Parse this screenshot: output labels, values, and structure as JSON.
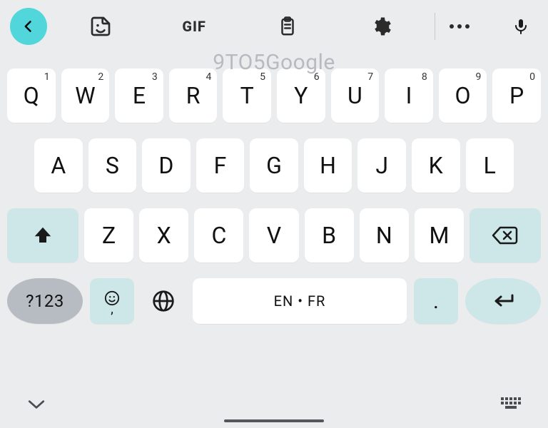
{
  "toolbar": {
    "gif_label": "GIF"
  },
  "watermark": "9TO5Google",
  "rows": {
    "r1": [
      {
        "l": "Q",
        "s": "1"
      },
      {
        "l": "W",
        "s": "2"
      },
      {
        "l": "E",
        "s": "3"
      },
      {
        "l": "R",
        "s": "4"
      },
      {
        "l": "T",
        "s": "5"
      },
      {
        "l": "Y",
        "s": "6"
      },
      {
        "l": "U",
        "s": "7"
      },
      {
        "l": "I",
        "s": "8"
      },
      {
        "l": "O",
        "s": "9"
      },
      {
        "l": "P",
        "s": "0"
      }
    ],
    "r2": [
      "A",
      "S",
      "D",
      "F",
      "G",
      "H",
      "J",
      "K",
      "L"
    ],
    "r3": [
      "Z",
      "X",
      "C",
      "V",
      "B",
      "N",
      "M"
    ]
  },
  "bottom": {
    "numbers_label": "?123",
    "comma": ",",
    "space_label": "EN • FR",
    "period": "."
  }
}
